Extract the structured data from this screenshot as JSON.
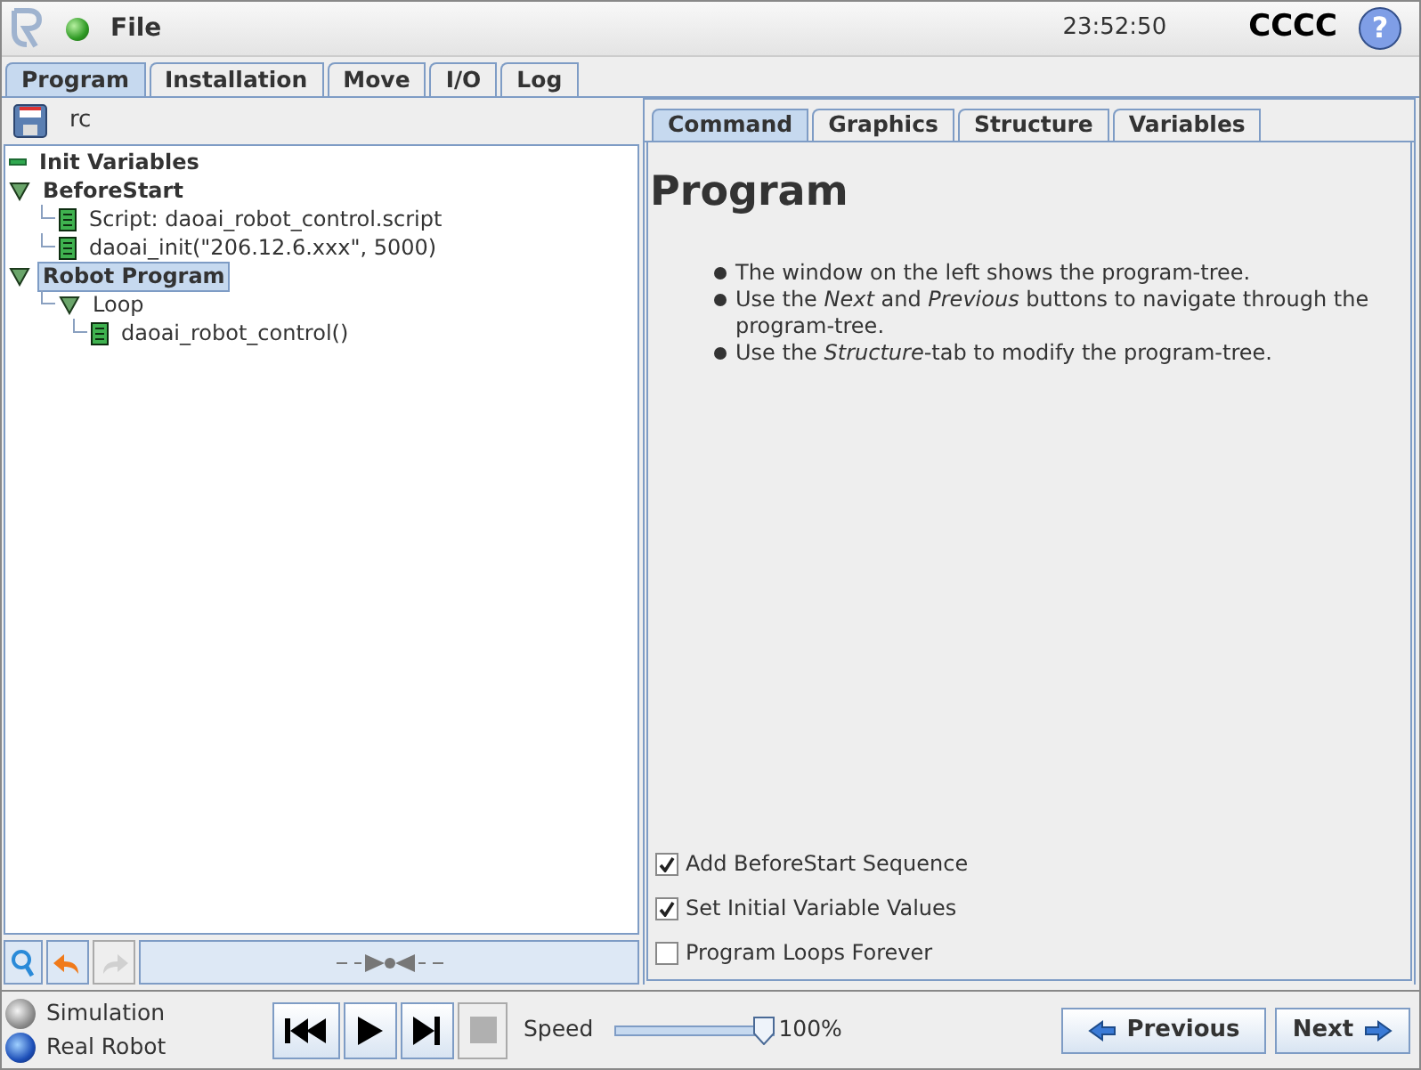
{
  "header": {
    "menu": "File",
    "time": "23:52:50",
    "robot_name": "CCCC",
    "help": "?"
  },
  "main_tabs": [
    {
      "label": "Program",
      "selected": true
    },
    {
      "label": "Installation",
      "selected": false
    },
    {
      "label": "Move",
      "selected": false
    },
    {
      "label": "I/O",
      "selected": false
    },
    {
      "label": "Log",
      "selected": false
    }
  ],
  "program_name": "rc",
  "tree": [
    {
      "label": "Init Variables",
      "kind": "vars",
      "bold": true,
      "selected": false
    },
    {
      "label": "BeforeStart",
      "kind": "folder",
      "bold": true,
      "selected": false,
      "expanded": true,
      "children": [
        {
          "label": "Script: daoai_robot_control.script",
          "kind": "script",
          "bold": false,
          "selected": false
        },
        {
          "label": "daoai_init(\"206.12.6.xxx\", 5000)",
          "kind": "script",
          "bold": false,
          "selected": false
        }
      ]
    },
    {
      "label": "Robot Program",
      "kind": "folder",
      "bold": true,
      "selected": true,
      "expanded": true,
      "children": [
        {
          "label": "Loop",
          "kind": "loop",
          "bold": false,
          "selected": false,
          "expanded": true,
          "children": [
            {
              "label": "daoai_robot_control()",
              "kind": "script",
              "bold": false,
              "selected": false
            }
          ]
        }
      ]
    }
  ],
  "tree_toolbar": {
    "undo_disabled": false,
    "redo_disabled": true
  },
  "side_tabs": [
    {
      "label": "Command",
      "selected": true
    },
    {
      "label": "Graphics",
      "selected": false
    },
    {
      "label": "Structure",
      "selected": false
    },
    {
      "label": "Variables",
      "selected": false
    }
  ],
  "command": {
    "title": "Program",
    "bullets": [
      "The window on the left shows the program-tree.",
      "Use the *Next* and *Previous* buttons to navigate through the program-tree.",
      "Use the *Structure*-tab to modify the program-tree."
    ],
    "options": [
      {
        "label": "Add BeforeStart Sequence",
        "checked": true
      },
      {
        "label": "Set Initial Variable Values",
        "checked": true
      },
      {
        "label": "Program Loops Forever",
        "checked": false
      }
    ]
  },
  "modes": [
    {
      "label": "Simulation",
      "selected": false
    },
    {
      "label": "Real Robot",
      "selected": true
    }
  ],
  "playback": {
    "stop_disabled": true
  },
  "speed": {
    "label": "Speed",
    "level": 1.0,
    "reading": "100%"
  },
  "nav": {
    "previous": "Previous",
    "next": "Next"
  }
}
